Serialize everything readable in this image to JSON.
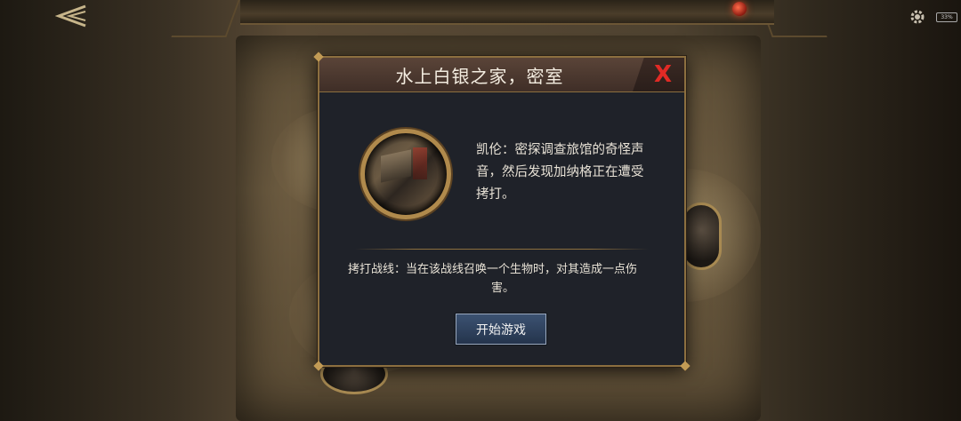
{
  "header": {
    "battery_label": "33%"
  },
  "dialog": {
    "title": "水上白银之家，密室",
    "story_line1": "凯伦：密探调查旅馆的奇怪声",
    "story_line2": "音，然后发现加纳格正在遭受",
    "story_line3": "拷打。",
    "rule_line1": "拷打战线：当在该战线召唤一个生物时，对其造成一点伤",
    "rule_line2": "害。",
    "start_label": "开始游戏",
    "close_label": "X"
  },
  "colors": {
    "close_accent": "#e12a25",
    "button_blue": "#2f4360",
    "frame_gold": "#8c6f3f"
  }
}
